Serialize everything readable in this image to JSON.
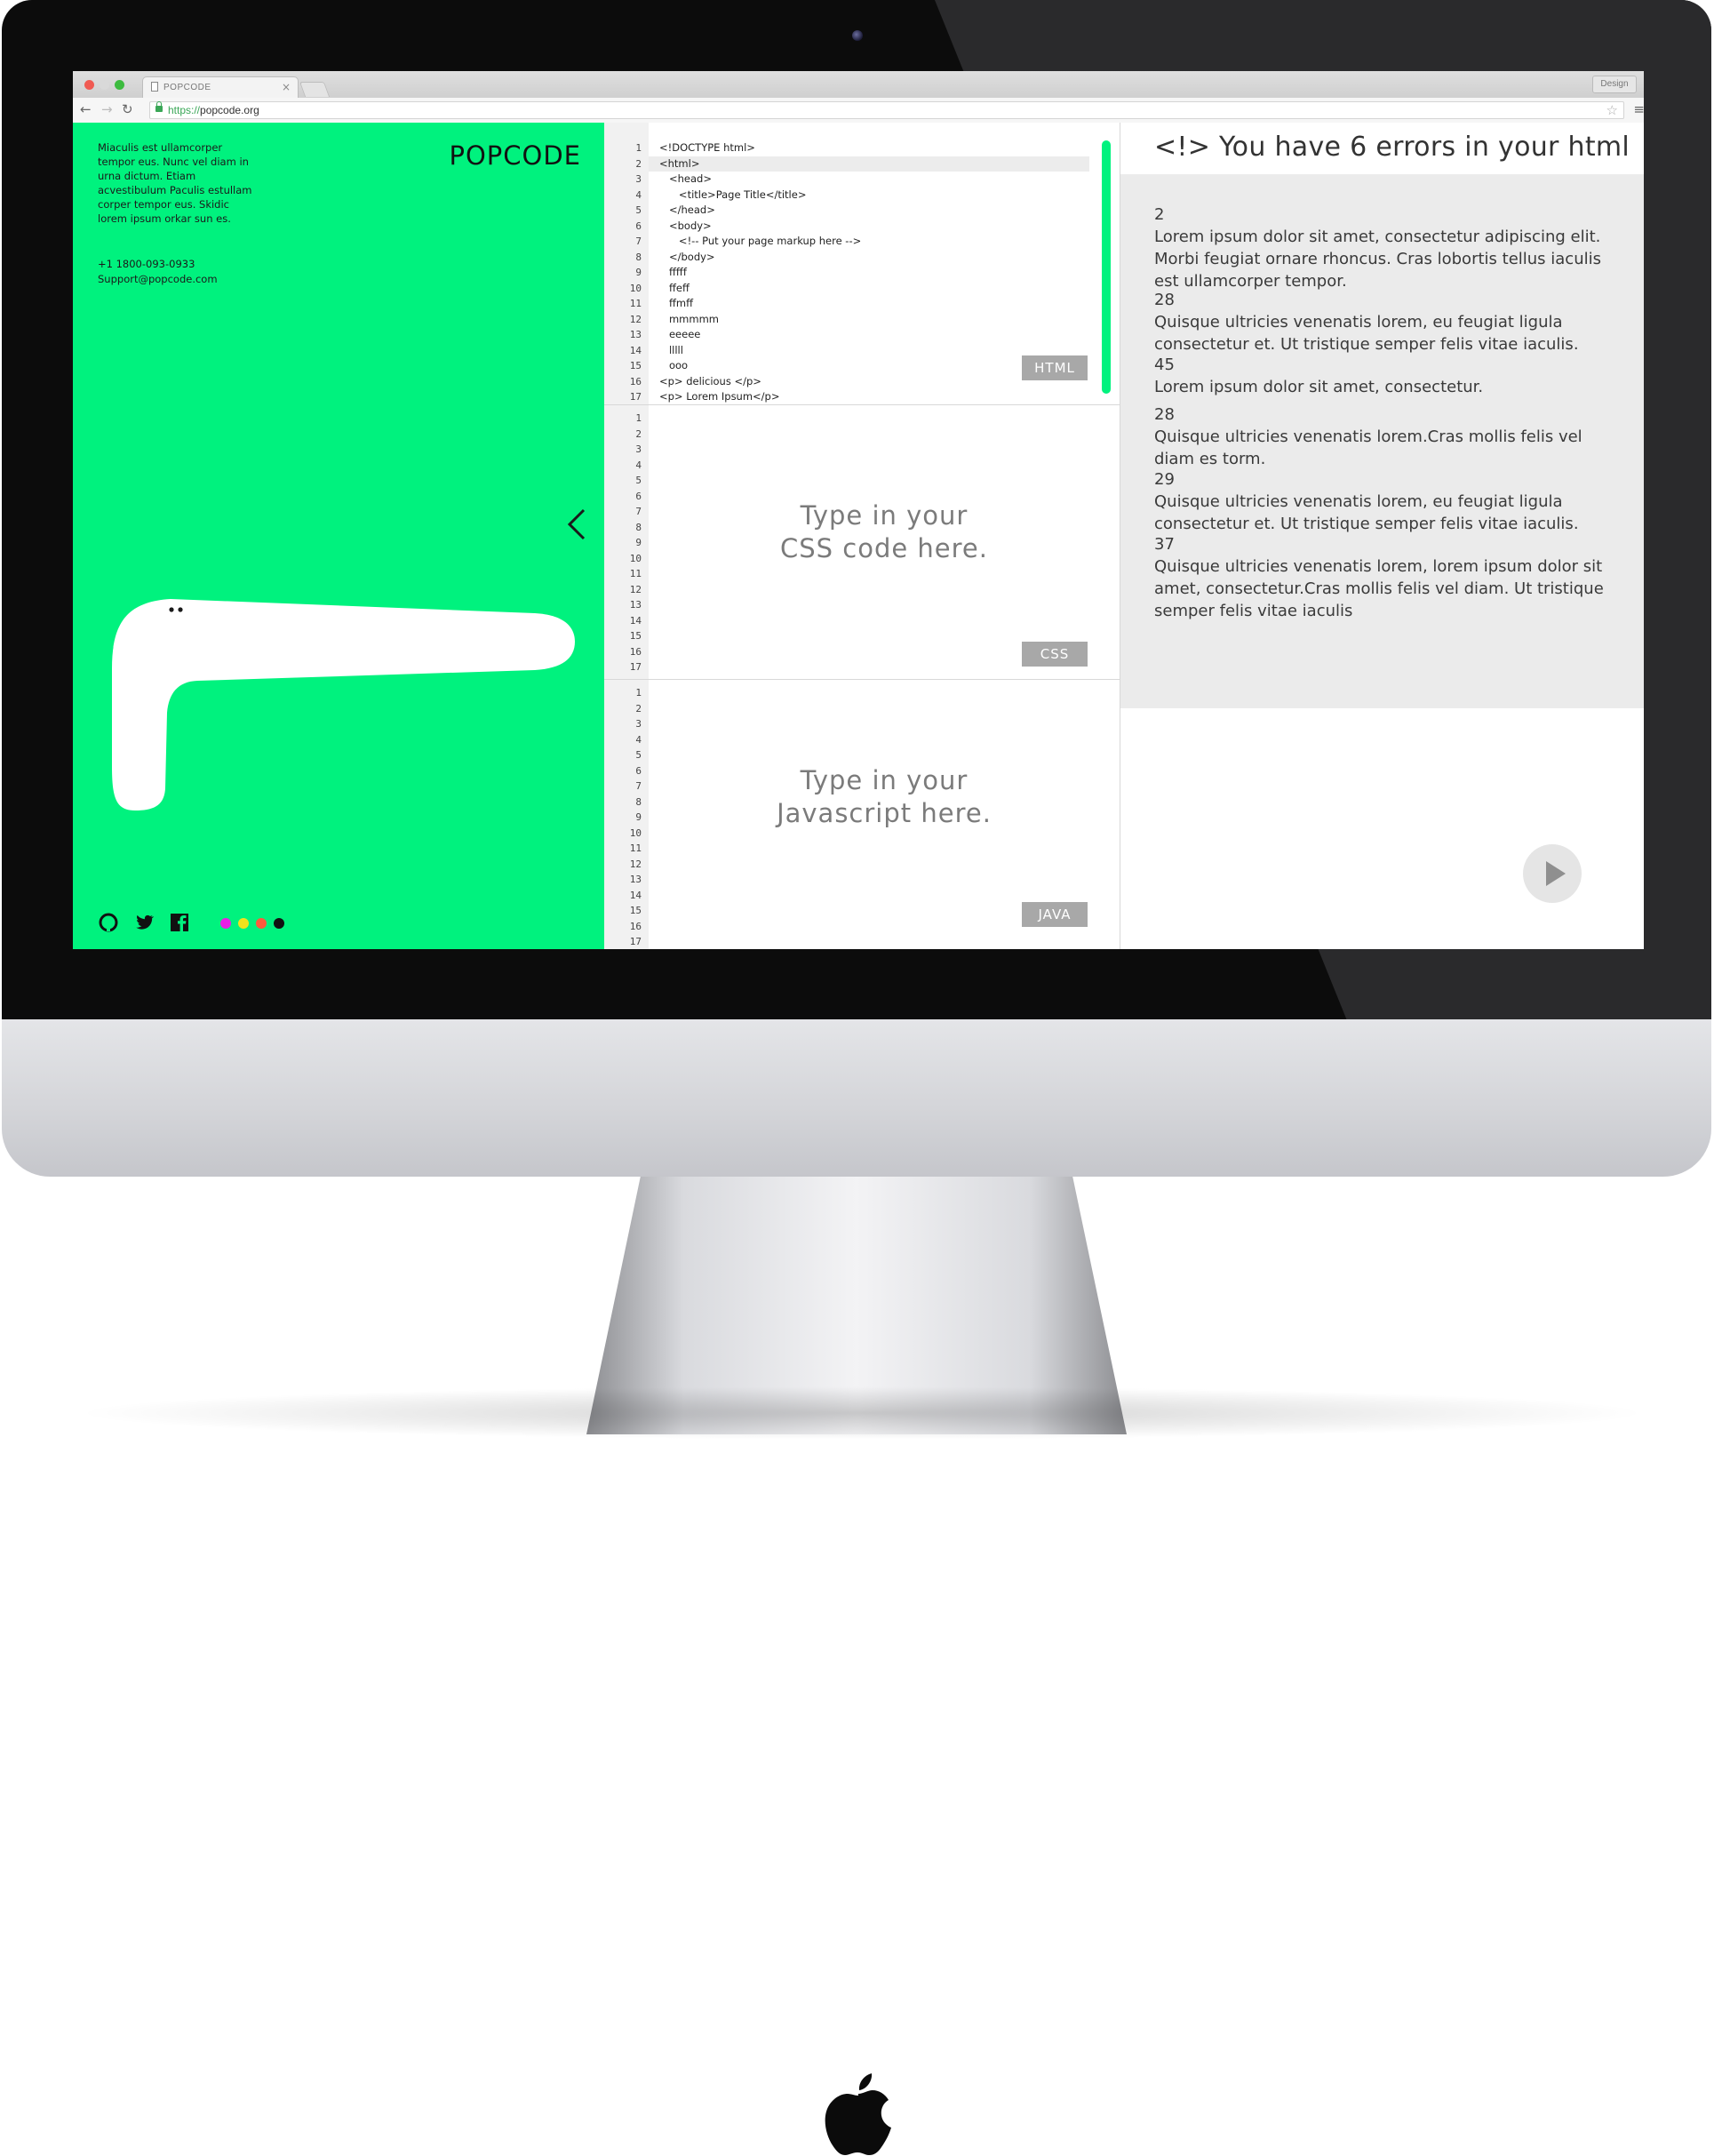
{
  "browser": {
    "tab_title": "POPCODE",
    "tab_close": "×",
    "profile_button": "Design",
    "url_protocol": "https://",
    "url_host": "popcode.org"
  },
  "sidebar": {
    "blurb": "Miaculis est ullamcorper tempor eus. Nunc vel diam in urna dictum. Etiam acvestibulum Paculis estullam corper tempor eus. Skidic lorem ipsum orkar sun es.",
    "phone": "+1 1800-093-0933",
    "email": "Support@popcode.com",
    "brand": "POPCODE",
    "social_icons": [
      "github-icon",
      "twitter-icon",
      "facebook-icon"
    ],
    "theme_swatches": [
      "#e91ee6",
      "#f3e21c",
      "#ff5a3c",
      "#111111"
    ],
    "accent_color": "#00f27e"
  },
  "editors": {
    "html": {
      "label": "HTML",
      "active_line": 2,
      "lines": [
        "<!DOCTYPE html>",
        "<html>",
        "   <head>",
        "      <title>Page Title</title>",
        "   </head>",
        "   <body>",
        "      <!-- Put your page markup here -->",
        "   </body>",
        "   fffff",
        "   ffeff",
        "   ffmff",
        "   mmmmm",
        "   eeeee",
        "   lllll",
        "   ooo",
        "<p> delicious </p>",
        "<p> Lorem Ipsum</p>"
      ],
      "line_numbers": [
        "1",
        "2",
        "3",
        "4",
        "5",
        "6",
        "7",
        "8",
        "9",
        "10",
        "11",
        "12",
        "13",
        "14",
        "15",
        "16",
        "17"
      ]
    },
    "css": {
      "label": "CSS",
      "placeholder_line1": "Type in your",
      "placeholder_line2": "CSS code here.",
      "line_numbers": [
        "1",
        "2",
        "3",
        "4",
        "5",
        "6",
        "7",
        "8",
        "9",
        "10",
        "11",
        "12",
        "13",
        "14",
        "15",
        "16",
        "17"
      ]
    },
    "js": {
      "label": "JAVA",
      "placeholder_line1": "Type in your",
      "placeholder_line2": "Javascript here.",
      "line_numbers": [
        "1",
        "2",
        "3",
        "4",
        "5",
        "6",
        "7",
        "8",
        "9",
        "10",
        "11",
        "12",
        "13",
        "14",
        "15",
        "16",
        "17"
      ]
    }
  },
  "errors": {
    "title": "<!> You have 6 errors in your html",
    "items": [
      {
        "line": "2",
        "message": "Lorem ipsum dolor sit amet, consectetur adipiscing elit. Morbi feugiat ornare rhoncus. Cras lobortis tellus iaculis est ullamcorper tempor."
      },
      {
        "line": "28",
        "message": "Quisque ultricies venenatis lorem, eu feugiat ligula consectetur et. Ut tristique semper felis vitae iaculis."
      },
      {
        "line": "45",
        "message": "Lorem ipsum dolor sit amet, consectetur."
      },
      {
        "line": "28",
        "message": "Quisque ultricies venenatis lorem.Cras mollis felis vel diam es torm."
      },
      {
        "line": "29",
        "message": "Quisque ultricies venenatis lorem, eu feugiat ligula consectetur et. Ut tristique semper felis vitae iaculis."
      },
      {
        "line": "37",
        "message": "Quisque ultricies venenatis lorem, lorem ipsum dolor sit amet, consectetur.Cras mollis felis vel diam. Ut tristique semper felis vitae iaculis"
      }
    ],
    "play_button_icon": "play-icon"
  }
}
